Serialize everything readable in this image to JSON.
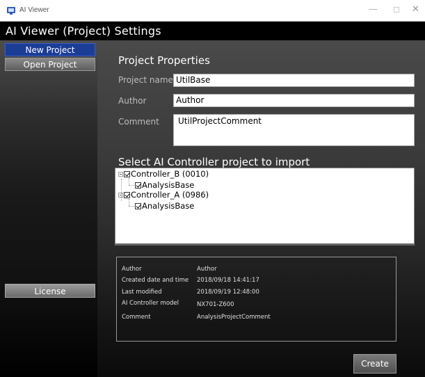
{
  "window": {
    "title": "AI Viewer",
    "minimize": "—",
    "maximize": "☐",
    "close": "✕"
  },
  "page_title": "AI Viewer (Project) Settings",
  "sidebar": {
    "new_project": "New Project",
    "open_project": "Open Project",
    "license": "License"
  },
  "properties": {
    "section_title": "Project Properties",
    "name_label": "Project name",
    "name_value": "UtilBase",
    "author_label": "Author",
    "author_value": "Author",
    "comment_label": "Comment",
    "comment_value": "UtilProjectComment"
  },
  "import": {
    "section_title": "Select AI Controller project to import",
    "tree": [
      {
        "label": "Controller_B (0010)",
        "checked": true,
        "expanded": true,
        "children": [
          {
            "label": "AnalysisBase",
            "checked": true
          }
        ]
      },
      {
        "label": "Controller_A (0986)",
        "checked": true,
        "expanded": true,
        "children": [
          {
            "label": "AnalysisBase",
            "checked": true
          }
        ]
      }
    ]
  },
  "info": {
    "rows": [
      {
        "label": "Author",
        "value": "Author"
      },
      {
        "label": "Created date and time",
        "value": "2018/09/18 14:41:17"
      },
      {
        "label": "Last modified",
        "value": "2018/09/19 12:48:00"
      },
      {
        "label": "AI Controller model",
        "value": "NX701-Z600"
      },
      {
        "label": "Comment",
        "value": "AnalysisProjectComment"
      }
    ]
  },
  "create_button": "Create",
  "colors": {
    "nav_active": "#1c3d96",
    "background": "#000000",
    "title_bar": "#ffffff"
  }
}
